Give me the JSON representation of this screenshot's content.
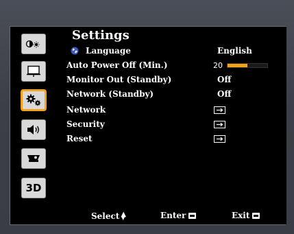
{
  "menu": {
    "title": "Settings",
    "rows": [
      {
        "label": "Language",
        "value": "English"
      },
      {
        "label": "Auto Power Off (Min.)",
        "value": "20"
      },
      {
        "label": "Monitor Out (Standby)",
        "value": "Off"
      },
      {
        "label": "Network (Standby)",
        "value": "Off"
      },
      {
        "label": "Network",
        "value": ""
      },
      {
        "label": "Security",
        "value": ""
      },
      {
        "label": "Reset",
        "value": ""
      }
    ],
    "auto_power_off_fill": 0.5
  },
  "sidebar": {
    "items": [
      {
        "name": "image-settings",
        "icon": "brightness-icon"
      },
      {
        "name": "display",
        "icon": "screen-icon"
      },
      {
        "name": "settings",
        "icon": "gears-icon",
        "active": true
      },
      {
        "name": "volume",
        "icon": "speaker-icon"
      },
      {
        "name": "options",
        "icon": "projector-icon"
      },
      {
        "name": "3d",
        "icon": "3d-icon",
        "label": "3D"
      }
    ]
  },
  "footer": {
    "select": "Select",
    "enter": "Enter",
    "exit": "Exit"
  },
  "colors": {
    "accent": "#f2a31b",
    "background": "#000000",
    "text": "#ffffff"
  }
}
